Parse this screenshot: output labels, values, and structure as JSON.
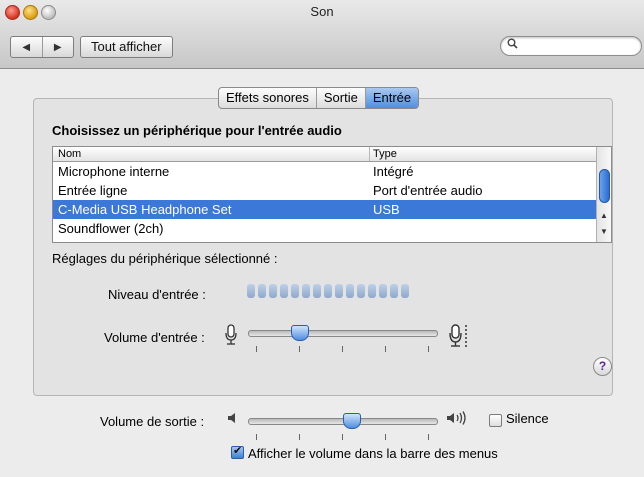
{
  "window": {
    "title": "Son",
    "show_all": "Tout afficher",
    "search_placeholder": ""
  },
  "tabs": [
    {
      "label": "Effets sonores",
      "active": false
    },
    {
      "label": "Sortie",
      "active": false
    },
    {
      "label": "Entrée",
      "active": true
    }
  ],
  "input": {
    "section_title": "Choisissez un périphérique pour l'entrée audio",
    "columns": {
      "name": "Nom",
      "type": "Type"
    },
    "devices": [
      {
        "name": "Microphone interne",
        "type": "Intégré"
      },
      {
        "name": "Entrée ligne",
        "type": "Port d'entrée audio"
      },
      {
        "name": "C-Media USB Headphone Set",
        "type": "USB",
        "selected": true
      },
      {
        "name": "Soundflower (2ch)",
        "type": ""
      }
    ],
    "settings_label": "Réglages du périphérique sélectionné :",
    "level_label": "Niveau d'entrée :",
    "level_segments": 15,
    "level_lit": 0,
    "volume_label": "Volume d'entrée :",
    "volume_value": 0.25
  },
  "output": {
    "volume_label": "Volume de sortie :",
    "volume_value": 0.55,
    "mute_label": "Silence",
    "mute_checked": false,
    "menubar_label": "Afficher le volume dans la barre des menus",
    "menubar_checked": true
  },
  "icons": {
    "search": "search-icon",
    "help": "help-icon",
    "mic": "microphone-icon",
    "speaker": "speaker-icon"
  }
}
